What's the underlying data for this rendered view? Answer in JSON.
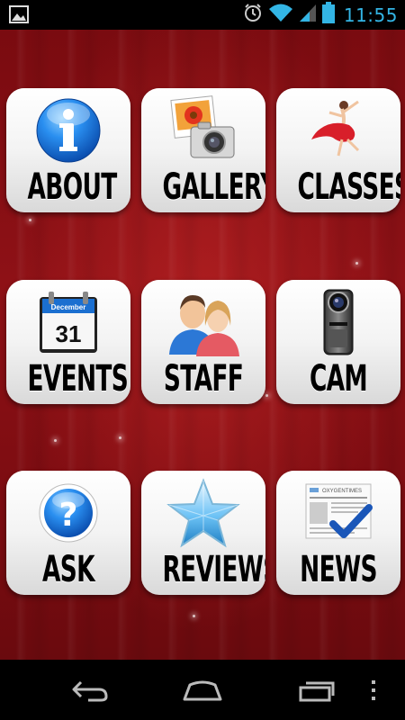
{
  "status_bar": {
    "time": "11:55",
    "icons": [
      "gallery-icon",
      "alarm-icon",
      "wifi-icon",
      "signal-icon",
      "battery-icon"
    ],
    "time_color": "#33b5e5"
  },
  "tiles": [
    {
      "label": "ABOUT",
      "icon": "info-icon"
    },
    {
      "label": "GALLERY",
      "icon": "photo-camera-icon"
    },
    {
      "label": "CLASSES",
      "icon": "dancer-icon"
    },
    {
      "label": "EVENTS",
      "icon": "calendar-icon"
    },
    {
      "label": "STAFF",
      "icon": "people-icon"
    },
    {
      "label": "CAM",
      "icon": "camcorder-icon"
    },
    {
      "label": "ASK",
      "icon": "question-icon"
    },
    {
      "label": "REVIEWS",
      "icon": "star-icon"
    },
    {
      "label": "NEWS",
      "icon": "newspaper-icon"
    }
  ],
  "calendar": {
    "month": "December",
    "day": "31"
  },
  "newspaper": {
    "masthead": "OXYGENTIMES"
  },
  "nav_bar": {
    "buttons": [
      "back-icon",
      "home-icon",
      "recent-apps-icon",
      "menu-icon"
    ]
  },
  "colors": {
    "background_red": "#8e1116",
    "info_blue": "#1f7fe0",
    "tile_white": "#f3f3f3"
  }
}
